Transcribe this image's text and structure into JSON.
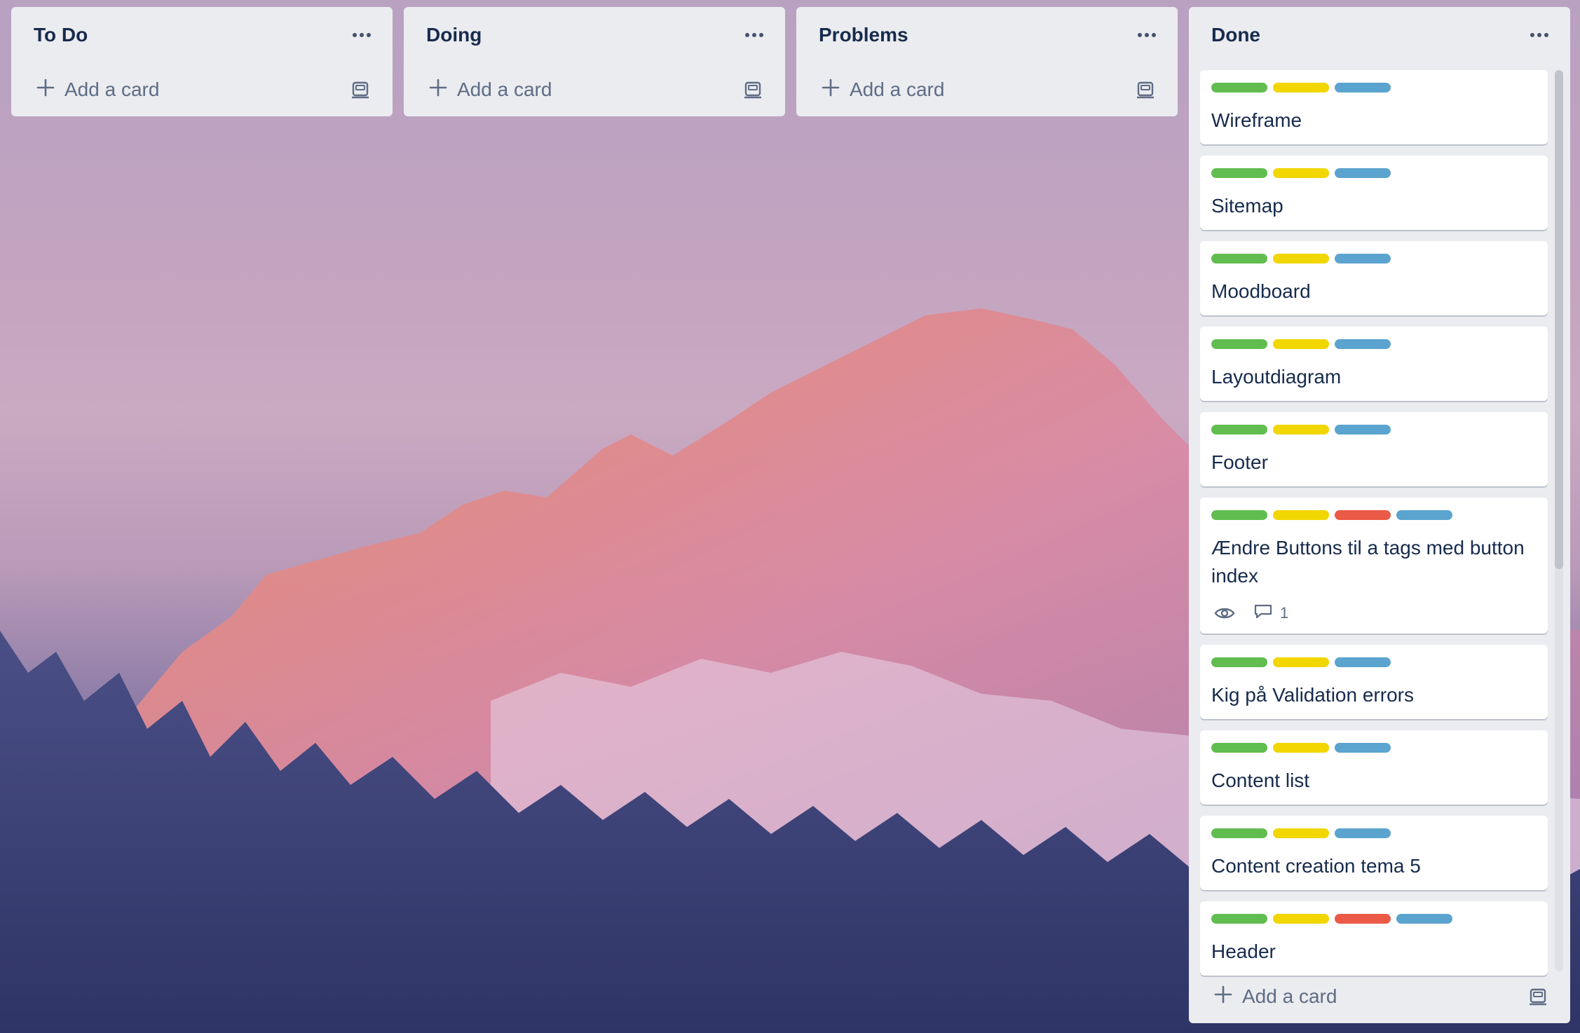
{
  "lists": [
    {
      "title": "To Do",
      "add_label": "Add a card"
    },
    {
      "title": "Doing",
      "add_label": "Add a card"
    },
    {
      "title": "Problems",
      "add_label": "Add a card"
    }
  ],
  "done": {
    "title": "Done",
    "add_label": "Add a card",
    "cards": [
      {
        "title": "Wireframe",
        "labels": [
          "green",
          "yellow",
          "blue"
        ]
      },
      {
        "title": "Sitemap",
        "labels": [
          "green",
          "yellow",
          "blue"
        ]
      },
      {
        "title": "Moodboard",
        "labels": [
          "green",
          "yellow",
          "blue"
        ]
      },
      {
        "title": "Layoutdiagram",
        "labels": [
          "green",
          "yellow",
          "blue"
        ]
      },
      {
        "title": "Footer",
        "labels": [
          "green",
          "yellow",
          "blue"
        ]
      },
      {
        "title": "Ændre Buttons til a tags med button index",
        "labels": [
          "green",
          "yellow",
          "red",
          "blue"
        ],
        "comments": "1"
      },
      {
        "title": "Kig på Validation errors",
        "labels": [
          "green",
          "yellow",
          "blue"
        ]
      },
      {
        "title": "Content list",
        "labels": [
          "green",
          "yellow",
          "blue"
        ]
      },
      {
        "title": "Content creation tema 5",
        "labels": [
          "green",
          "yellow",
          "blue"
        ]
      },
      {
        "title": "Header",
        "labels": [
          "green",
          "yellow",
          "red",
          "blue"
        ]
      }
    ]
  },
  "label_colors": {
    "green": "#61bd4f",
    "yellow": "#f2d600",
    "red": "#eb5a46",
    "blue": "#5ba4cf"
  },
  "icons": {
    "menu": "ellipsis-icon",
    "add": "plus-icon",
    "template": "card-template-icon",
    "watch": "eye-icon",
    "comment": "comment-icon"
  }
}
